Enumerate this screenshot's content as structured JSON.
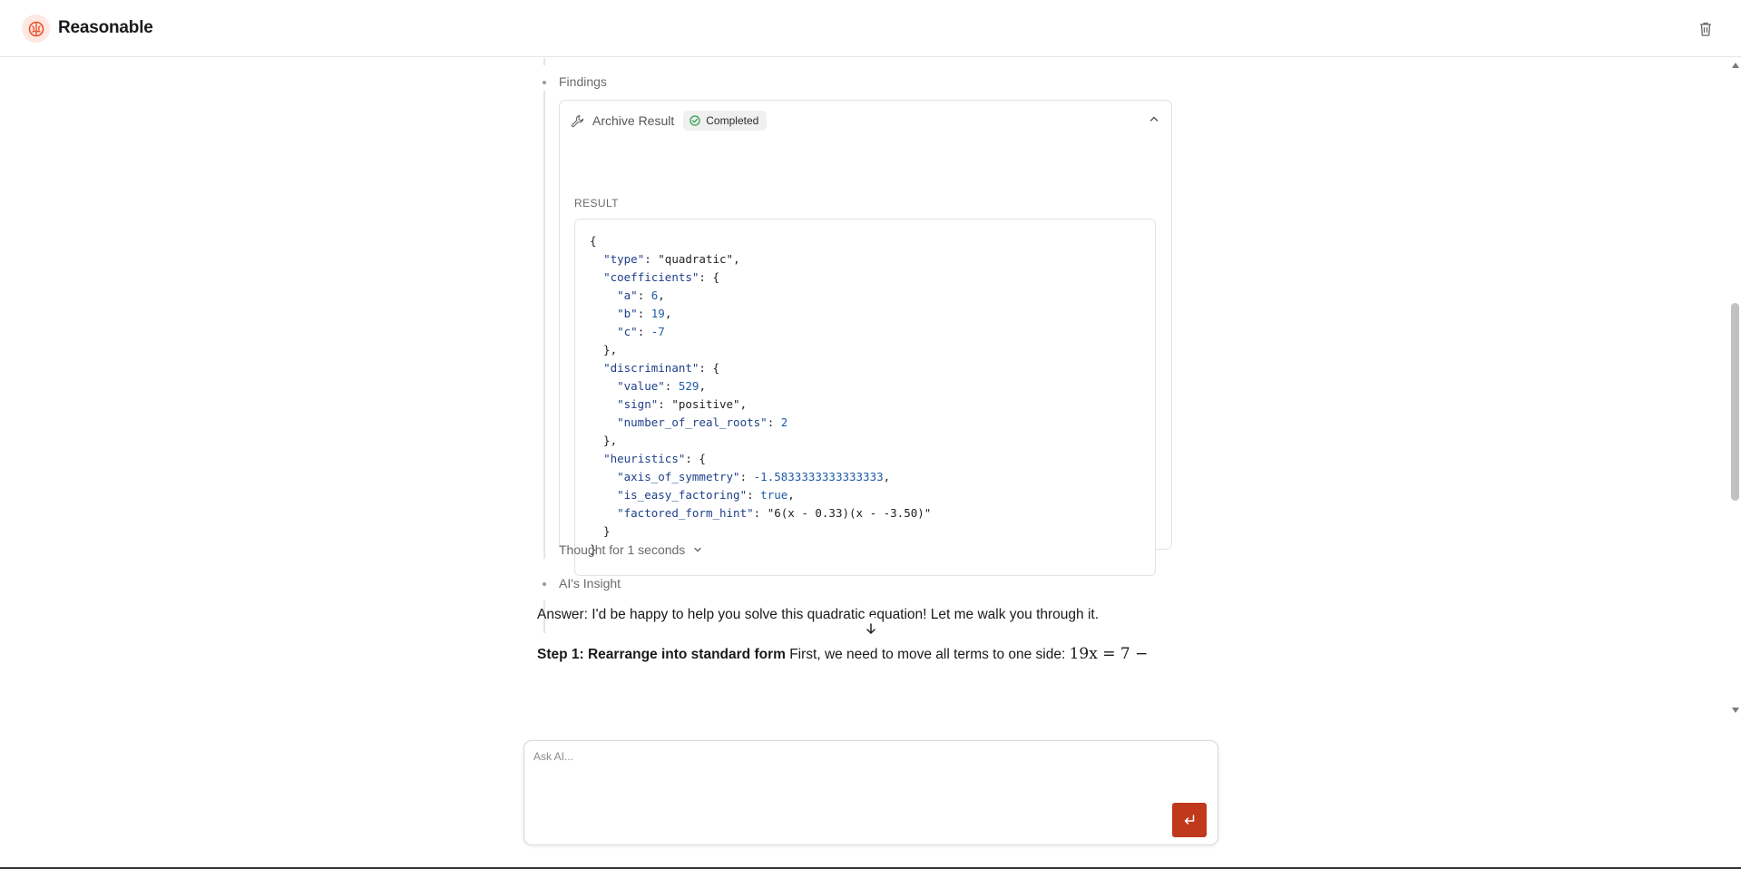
{
  "app": {
    "name": "Reasonable",
    "logo_icon": "brain-icon",
    "brand_color": "#e8532c"
  },
  "header": {
    "delete_icon": "trash-icon"
  },
  "timeline": {
    "findings_label": "Findings",
    "insight_label": "AI's Insight",
    "thought_label": "Thought for 1 seconds"
  },
  "tool_card": {
    "title": "Archive Result",
    "status": "Completed",
    "status_color": "#2e9e4e",
    "result_label": "RESULT",
    "code": {
      "open": "{",
      "type_key": "\"type\"",
      "type_val": "\"quadratic\"",
      "coef_key": "\"coefficients\"",
      "a_key": "\"a\"",
      "a_val": "6",
      "b_key": "\"b\"",
      "b_val": "19",
      "c_key": "\"c\"",
      "c_val": "-7",
      "disc_key": "\"discriminant\"",
      "value_key": "\"value\"",
      "value_val": "529",
      "sign_key": "\"sign\"",
      "sign_val": "\"positive\"",
      "roots_key": "\"number_of_real_roots\"",
      "roots_val": "2",
      "heur_key": "\"heuristics\"",
      "axis_key": "\"axis_of_symmetry\"",
      "axis_val": "-1.5833333333333333",
      "easy_key": "\"is_easy_factoring\"",
      "easy_val": "true",
      "hint_key": "\"factored_form_hint\"",
      "hint_val": "\"6(x - 0.33)(x - -3.50)\"",
      "close": "}"
    }
  },
  "answer": {
    "text": "Answer: I'd be happy to help you solve this quadratic equation! Let me walk you through it.",
    "step1_title": "Step 1: Rearrange into standard form",
    "step1_text": " First, we need to move all terms to one side: ",
    "step1_math": "19x = 7 −"
  },
  "composer": {
    "placeholder": "Ask AI...",
    "send_icon": "enter-icon"
  }
}
